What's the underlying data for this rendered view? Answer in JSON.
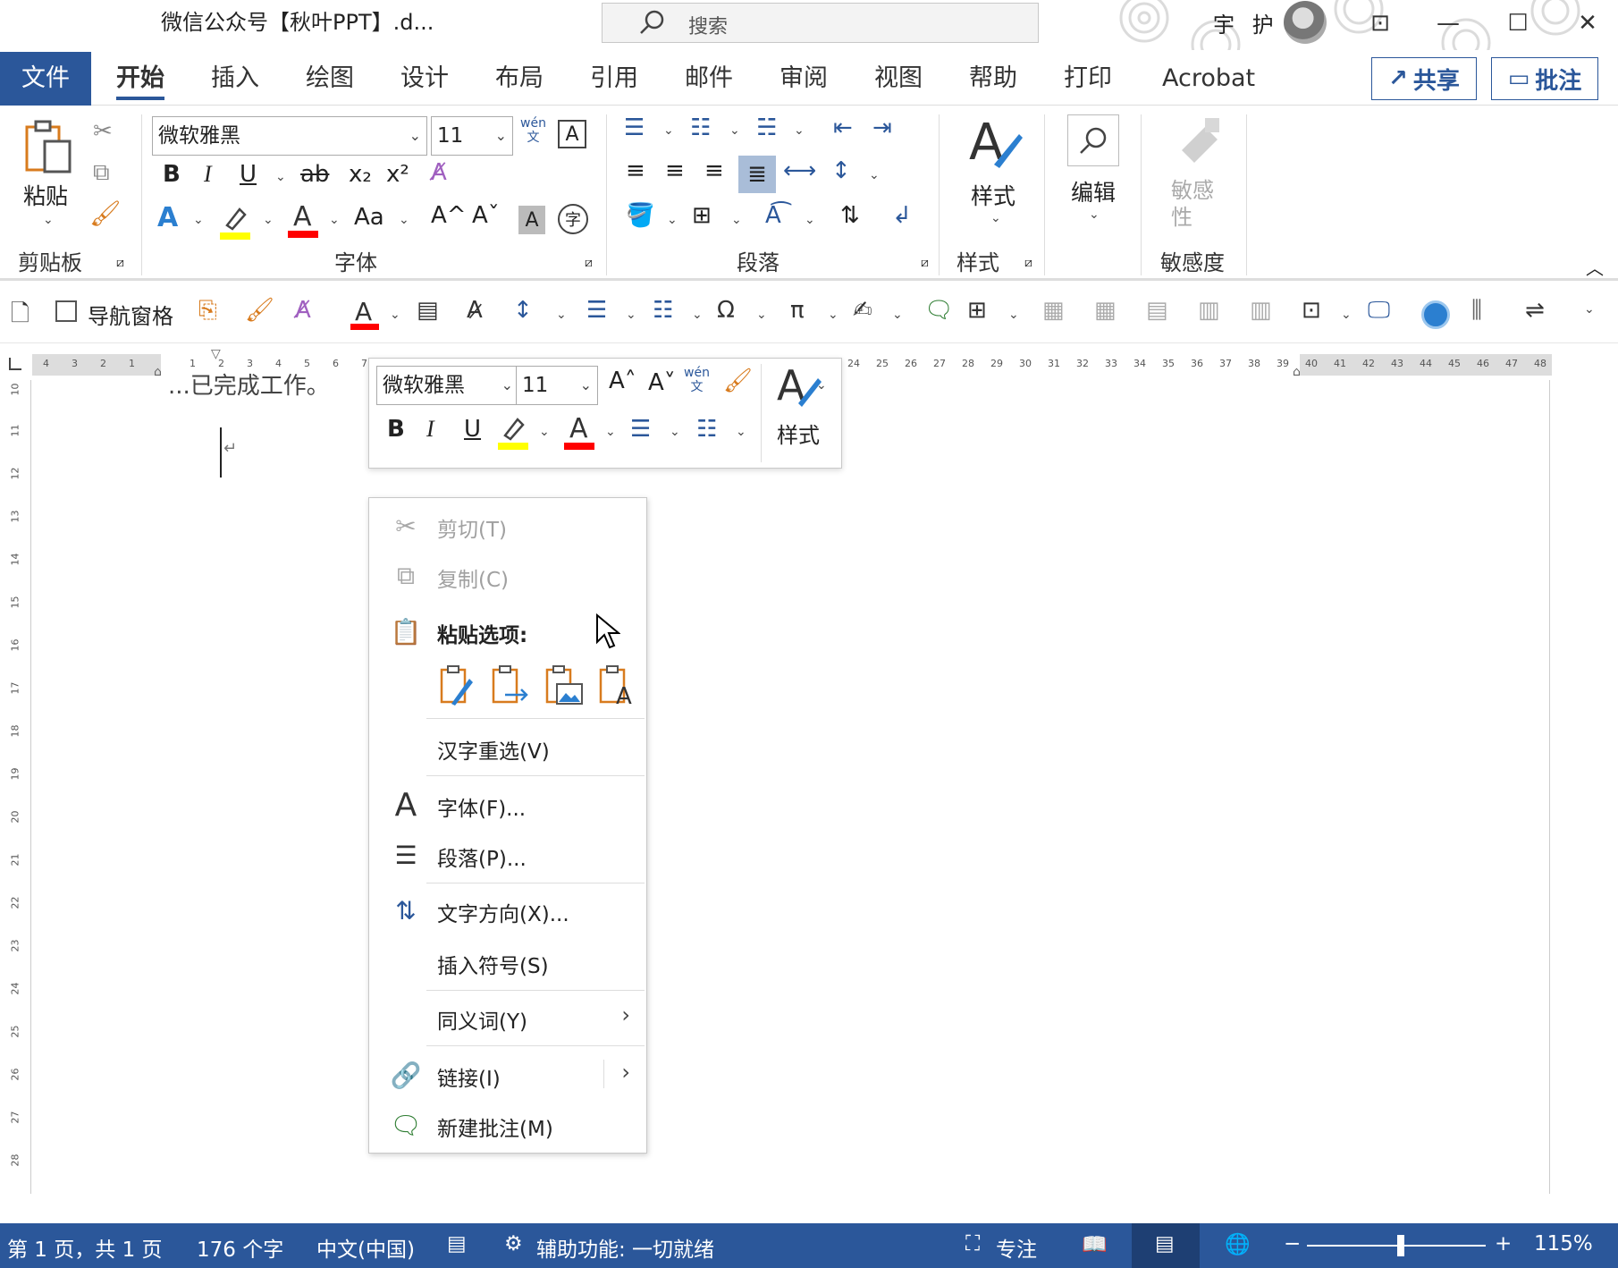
{
  "window": {
    "title": "微信公众号【秋叶PPT】.d...",
    "search_placeholder": "搜索",
    "user": "宇 护",
    "buttons": {
      "restore_ribbon": "⊡",
      "minimize": "—",
      "maximize": "☐",
      "close": "✕"
    }
  },
  "tabs": [
    {
      "label": "文件"
    },
    {
      "label": "开始"
    },
    {
      "label": "插入"
    },
    {
      "label": "绘图"
    },
    {
      "label": "设计"
    },
    {
      "label": "布局"
    },
    {
      "label": "引用"
    },
    {
      "label": "邮件"
    },
    {
      "label": "审阅"
    },
    {
      "label": "视图"
    },
    {
      "label": "帮助"
    },
    {
      "label": "打印"
    },
    {
      "label": "Acrobat"
    }
  ],
  "top_buttons": {
    "share": "共享",
    "comment": "批注"
  },
  "ribbon": {
    "clipboard": {
      "paste": "粘贴",
      "group": "剪贴板"
    },
    "font": {
      "name": "微软雅黑",
      "size": "11",
      "group": "字体",
      "bold": "B",
      "italic": "I",
      "underline": "U",
      "strike": "ab",
      "sub": "x₂",
      "sup": "x²",
      "aa": "Aa",
      "grow": "A^",
      "shrink": "Aˇ",
      "phonetic": "wén\n文",
      "char": "字"
    },
    "paragraph": {
      "group": "段落"
    },
    "styles": {
      "label": "样式",
      "group": "样式"
    },
    "editing": {
      "label": "编辑"
    },
    "sensitivity": {
      "label": "敏感\n性",
      "group": "敏感度"
    }
  },
  "qat": {
    "nav_pane": "导航窗格"
  },
  "ruler": {
    "left_numbers": [
      "4",
      "3",
      "2",
      "1"
    ],
    "numbers": [
      "1",
      "2",
      "3",
      "4",
      "5",
      "6",
      "7"
    ],
    "right_numbers": [
      "24",
      "25",
      "26",
      "27",
      "28",
      "29",
      "30",
      "31",
      "32",
      "33",
      "34",
      "35",
      "36",
      "37",
      "38",
      "39",
      "40",
      "41",
      "42",
      "43",
      "44",
      "45",
      "46",
      "47",
      "48"
    ],
    "vertical": [
      "10",
      "11",
      "12",
      "13",
      "14",
      "15",
      "16",
      "17",
      "18",
      "19",
      "20",
      "21",
      "22",
      "23",
      "24",
      "25",
      "26",
      "27",
      "28"
    ]
  },
  "doc": {
    "text_fragment": "...已完成工作。"
  },
  "mini_toolbar": {
    "font": "微软雅黑",
    "size": "11",
    "bold": "B",
    "italic": "I",
    "underline": "U",
    "styles": "样式"
  },
  "context_menu": {
    "cut": "剪切(T)",
    "copy": "复制(C)",
    "paste_options": "粘贴选项:",
    "reconvert": "汉字重选(V)",
    "font": "字体(F)...",
    "paragraph": "段落(P)...",
    "text_direction": "文字方向(X)...",
    "insert_symbol": "插入符号(S)",
    "synonyms": "同义词(Y)",
    "link": "链接(I)",
    "new_comment": "新建批注(M)"
  },
  "status": {
    "page": "第 1 页，共 1 页",
    "words": "176 个字",
    "language": "中文(中国)",
    "accessibility": "辅助功能: 一切就绪",
    "focus": "专注",
    "zoom": "115%",
    "zoom_percent": 115
  },
  "colors": {
    "accent": "#2b579a",
    "highlight": "#ffff00",
    "font_red": "#ff0000"
  }
}
